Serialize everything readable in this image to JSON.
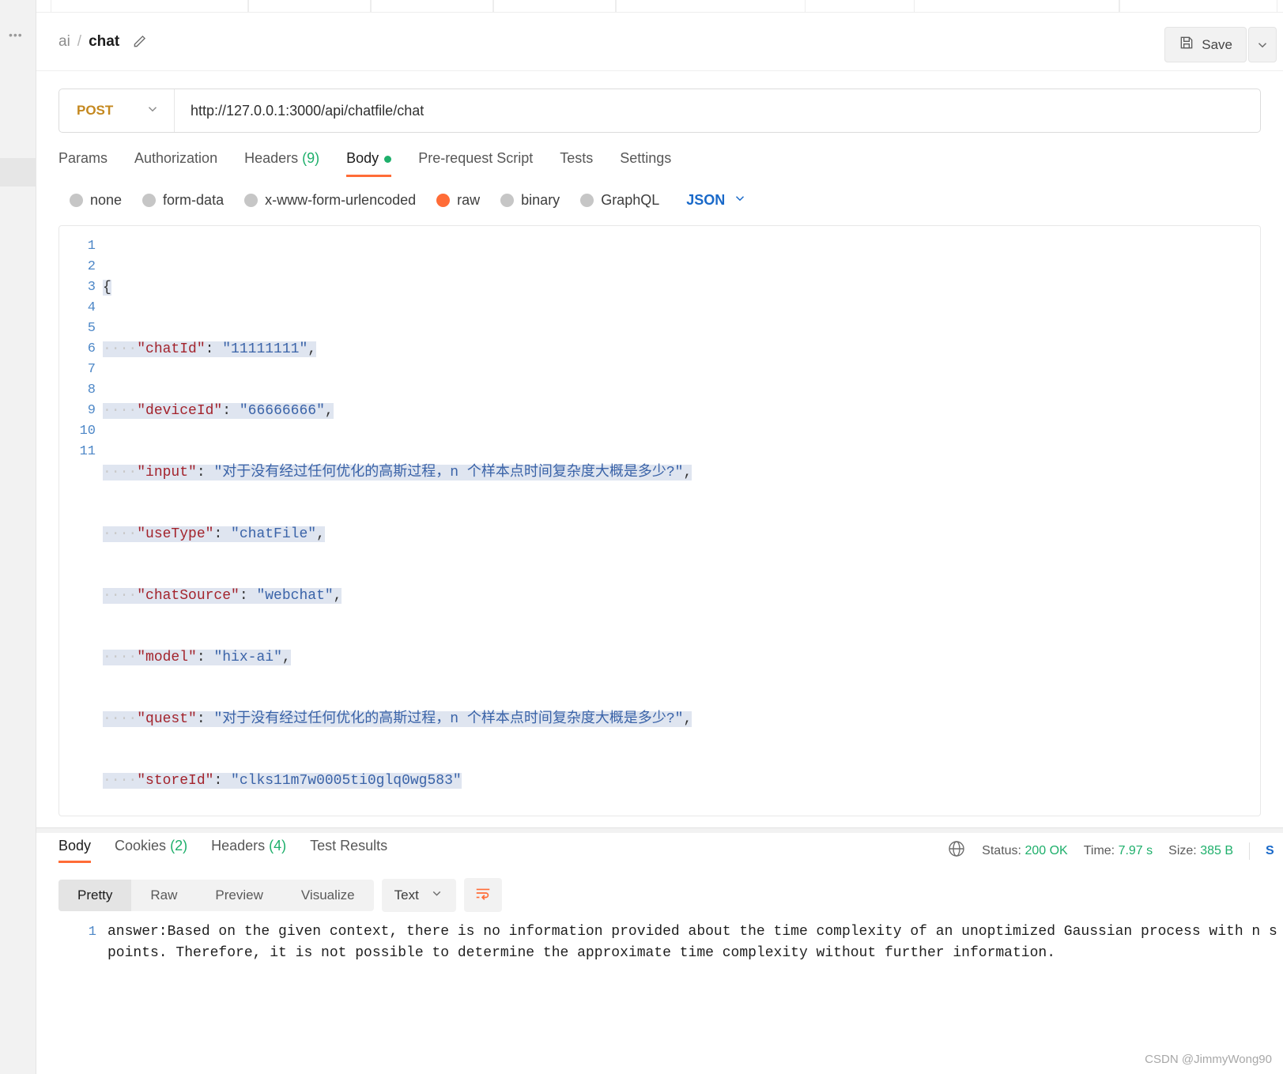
{
  "window": {
    "watermark": "CSDN @JimmyWong90"
  },
  "request": {
    "breadcrumb": {
      "parent": "ai",
      "separator": "/",
      "current": "chat",
      "edit_icon": "pencil-icon"
    },
    "save_label": "Save",
    "save_icon": "floppy-disk-icon",
    "save_caret_icon": "chevron-down-icon",
    "method": "POST",
    "method_caret_icon": "chevron-down-icon",
    "url": "http://127.0.0.1:3000/api/chatfile/chat",
    "tabs": [
      {
        "label": "Params",
        "active": false
      },
      {
        "label": "Authorization",
        "active": false
      },
      {
        "label": "Headers",
        "count": "(9)",
        "active": false
      },
      {
        "label": "Body",
        "active": true,
        "dot": true
      },
      {
        "label": "Pre-request Script",
        "active": false
      },
      {
        "label": "Tests",
        "active": false
      },
      {
        "label": "Settings",
        "active": false
      }
    ],
    "body_types": [
      {
        "label": "none",
        "selected": false
      },
      {
        "label": "form-data",
        "selected": false
      },
      {
        "label": "x-www-form-urlencoded",
        "selected": false
      },
      {
        "label": "raw",
        "selected": true
      },
      {
        "label": "binary",
        "selected": false
      },
      {
        "label": "GraphQL",
        "selected": false
      }
    ],
    "raw_format": "JSON",
    "raw_format_caret_icon": "chevron-down-icon",
    "editor": {
      "line_numbers": [
        "1",
        "2",
        "3",
        "4",
        "5",
        "6",
        "7",
        "8",
        "9",
        "10",
        "11"
      ],
      "lines": [
        {
          "n": 1,
          "text": "{"
        },
        {
          "n": 2,
          "key": "\"chatId\"",
          "value": "\"11111111\"",
          "comma": ","
        },
        {
          "n": 3,
          "key": "\"deviceId\"",
          "value": "\"66666666\"",
          "comma": ","
        },
        {
          "n": 4,
          "key": "\"input\"",
          "value": "\"对于没有经过任何优化的高斯过程，n 个样本点时间复杂度大概是多少?\"",
          "comma": ","
        },
        {
          "n": 5,
          "key": "\"useType\"",
          "value": "\"chatFile\"",
          "comma": ","
        },
        {
          "n": 6,
          "key": "\"chatSource\"",
          "value": "\"webchat\"",
          "comma": ","
        },
        {
          "n": 7,
          "key": "\"model\"",
          "value": "\"hix-ai\"",
          "comma": ","
        },
        {
          "n": 8,
          "key": "\"quest\"",
          "value": "\"对于没有经过任何优化的高斯过程，n 个样本点时间复杂度大概是多少?\"",
          "comma": ","
        },
        {
          "n": 9,
          "key": "\"storeId\"",
          "value": "\"clks11m7w0005ti0glq0wg583\"",
          "comma": ""
        },
        {
          "n": 10,
          "text": ""
        },
        {
          "n": 11,
          "text": "}"
        }
      ]
    }
  },
  "response": {
    "tabs": [
      {
        "label": "Body",
        "active": true
      },
      {
        "label": "Cookies",
        "count": "(2)",
        "active": false
      },
      {
        "label": "Headers",
        "count": "(4)",
        "active": false
      },
      {
        "label": "Test Results",
        "active": false
      }
    ],
    "globe_icon": "globe-icon",
    "status_label": "Status:",
    "status_value": "200 OK",
    "time_label": "Time:",
    "time_value": "7.97 s",
    "size_label": "Size:",
    "size_value": "385 B",
    "overflow_text": "S",
    "views": [
      {
        "label": "Pretty",
        "active": true
      },
      {
        "label": "Raw",
        "active": false
      },
      {
        "label": "Preview",
        "active": false
      },
      {
        "label": "Visualize",
        "active": false
      }
    ],
    "type_select": "Text",
    "type_select_caret_icon": "chevron-down-icon",
    "wrap_icon": "wrap-lines-icon",
    "body_line_numbers": [
      "1"
    ],
    "body_text": "answer:Based on the given context, there is no information provided about the time complexity of an unoptimized Gaussian process with n s\npoints. Therefore, it is not possible to determine the approximate time complexity without further information."
  }
}
